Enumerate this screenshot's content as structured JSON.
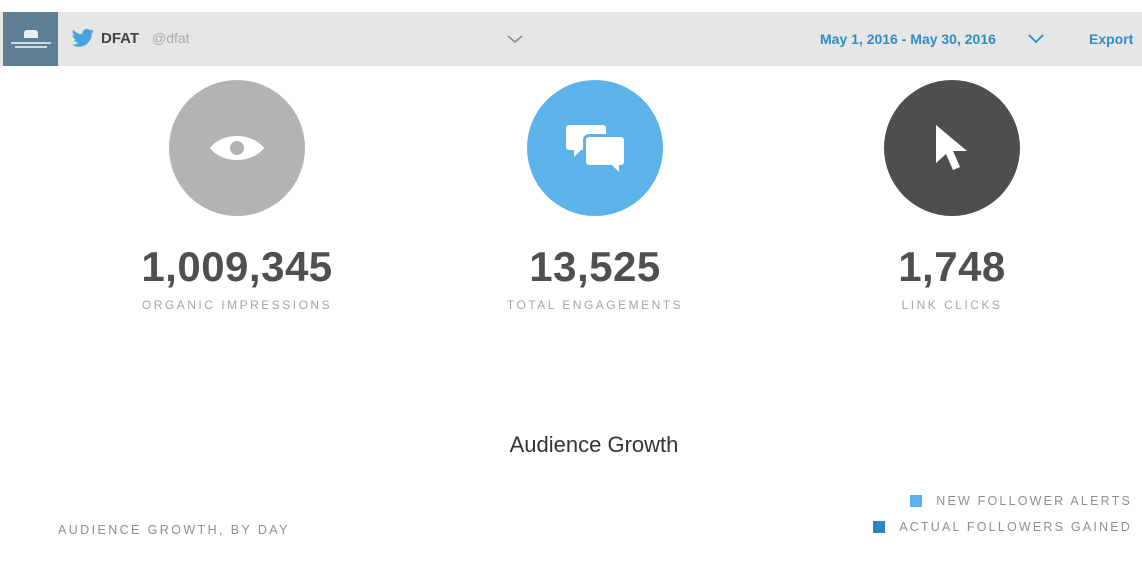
{
  "header": {
    "account_name": "DFAT",
    "account_handle": "@dfat",
    "date_range": "May 1, 2016 - May 30, 2016",
    "export_label": "Export"
  },
  "metrics": [
    {
      "value": "1,009,345",
      "label": "ORGANIC IMPRESSIONS",
      "icon": "eye-icon",
      "color": "#b3b3b3"
    },
    {
      "value": "13,525",
      "label": "TOTAL ENGAGEMENTS",
      "icon": "chat-bubbles-icon",
      "color": "#5cb3ea"
    },
    {
      "value": "1,748",
      "label": "LINK CLICKS",
      "icon": "cursor-arrow-icon",
      "color": "#4e4e4e"
    }
  ],
  "audience": {
    "title": "Audience Growth",
    "subtitle": "AUDIENCE GROWTH, BY DAY",
    "legend": [
      {
        "label": "NEW FOLLOWER ALERTS",
        "color": "#5cb3ea"
      },
      {
        "label": "ACTUAL FOLLOWERS GAINED",
        "color": "#2f84c0"
      }
    ]
  }
}
